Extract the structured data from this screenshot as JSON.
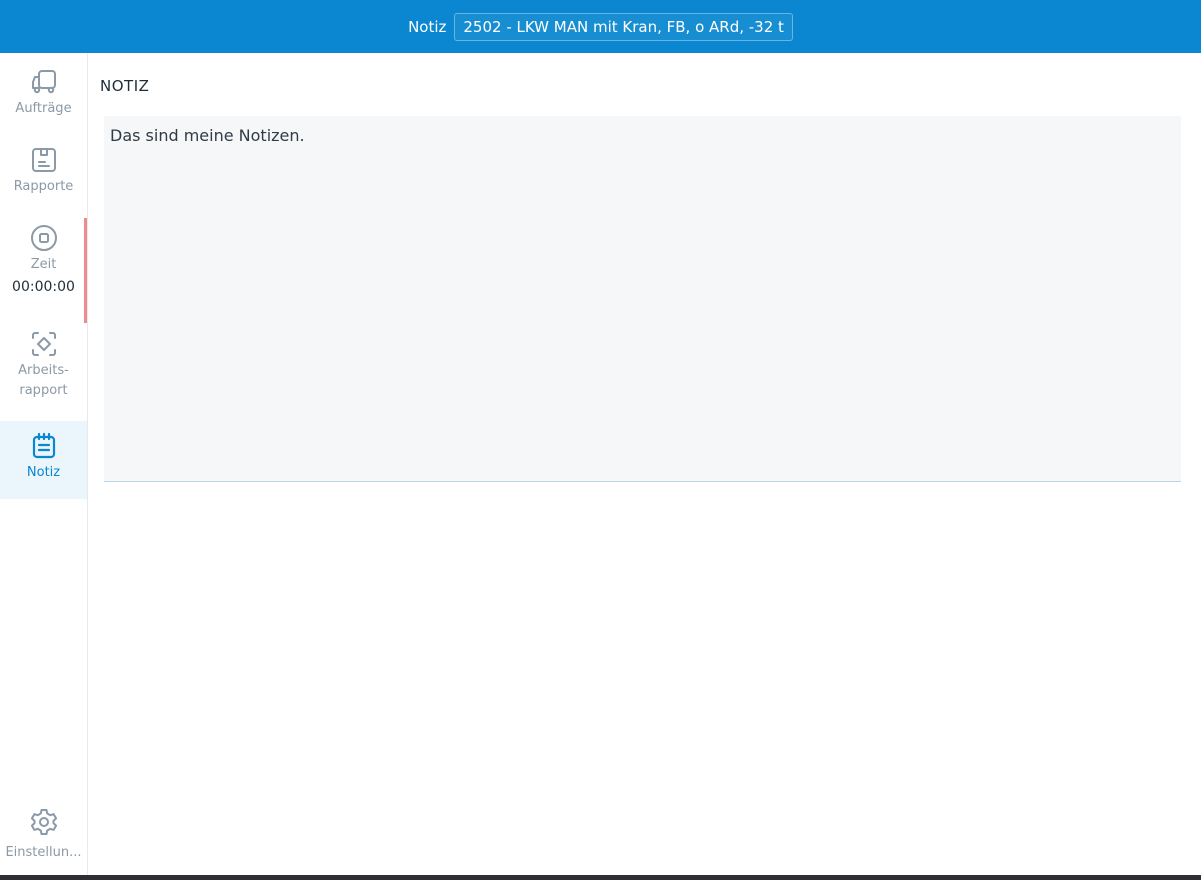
{
  "header": {
    "title": "Notiz",
    "vehicle": "2502 - LKW MAN mit Kran, FB, o ARd, -32 t"
  },
  "sidebar": {
    "items": [
      {
        "label": "Aufträge",
        "icon": "truck-icon"
      },
      {
        "label": "Rapporte",
        "icon": "report-icon"
      },
      {
        "label": "Zeit",
        "time": "00:00:00",
        "icon": "stop-icon"
      },
      {
        "label": "Arbeits-\nrapport",
        "icon": "scan-icon"
      },
      {
        "label": "Notiz",
        "icon": "notepad-icon",
        "active": true
      }
    ],
    "settings": {
      "label": "Einstellun...",
      "icon": "gear-icon"
    }
  },
  "main": {
    "section_title": "NOTIZ",
    "note_text": "Das sind meine Notizen."
  },
  "colors": {
    "header_bg": "#0a87d0",
    "active_bg": "#eaf5fc",
    "accent": "#0a87d0",
    "zeit_indicator": "#ef8b8b"
  }
}
